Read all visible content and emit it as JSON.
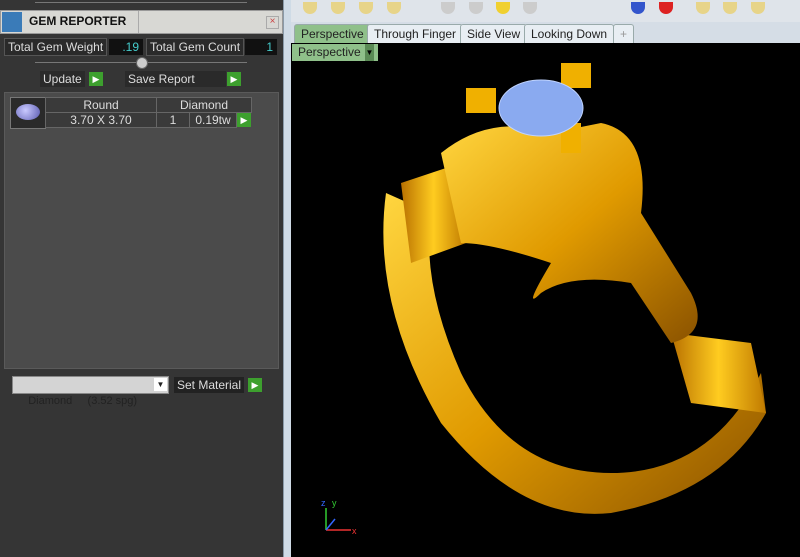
{
  "panel": {
    "title": "GEM REPORTER",
    "close_icon": "×",
    "total_weight_label": "Total Gem Weight",
    "total_weight": ".19",
    "total_count_label": "Total Gem Count",
    "total_count": "1",
    "update": "Update",
    "save_report": "Save Report",
    "gem": {
      "shape": "Round",
      "material": "Diamond",
      "size": "3.70 X 3.70",
      "qty": "1",
      "weight": "0.19tw"
    },
    "material_select": "Diamond     (3.52 spg)",
    "set_material": "Set Material"
  },
  "viewport": {
    "tabs": [
      "Perspective",
      "Through Finger",
      "Side View",
      "Looking Down",
      "+"
    ],
    "active_tab": "Perspective",
    "view_label": "Perspective",
    "axes": {
      "x": "x",
      "y": "y",
      "z": "z"
    }
  },
  "colors": {
    "accent_green": "#8fc08a",
    "go_button": "#3da02e",
    "gold": "#e8a800"
  }
}
